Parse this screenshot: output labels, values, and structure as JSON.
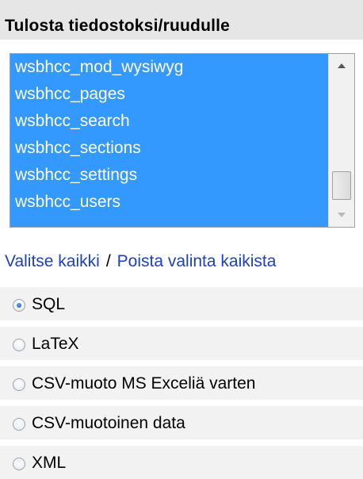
{
  "panel": {
    "title": "Tulosta tiedostoksi/ruudulle"
  },
  "table_list": {
    "items": [
      "wsbhcc_mod_wysiwyg",
      "wsbhcc_pages",
      "wsbhcc_search",
      "wsbhcc_sections",
      "wsbhcc_settings",
      "wsbhcc_users"
    ],
    "selection_color": "#3399ff"
  },
  "select_links": {
    "select_all": "Valitse kaikki",
    "separator": "/",
    "deselect_all": "Poista valinta kaikista",
    "link_color": "#1c3fc5"
  },
  "formats": {
    "selected": "SQL",
    "options": [
      "SQL",
      "LaTeX",
      "CSV-muoto MS Exceliä varten",
      "CSV-muotoinen data",
      "XML"
    ]
  }
}
